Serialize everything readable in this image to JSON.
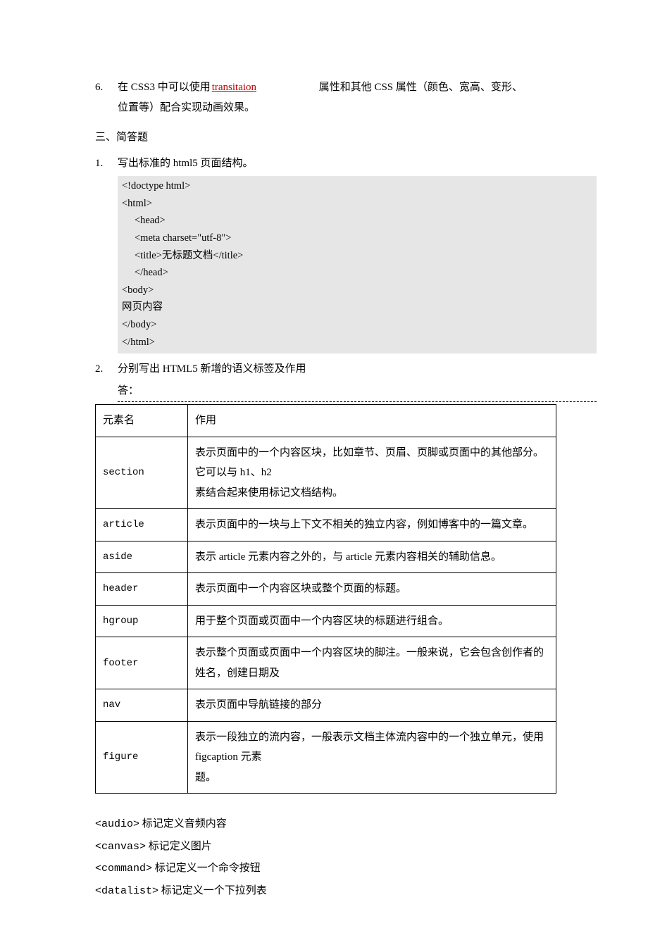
{
  "q6": {
    "num": "6.",
    "pre": "在 CSS3 中可以使用",
    "blank": " transitaion          ",
    "post": "属性和其他 CSS 属性（颜色、宽高、变形、",
    "line2": "位置等）配合实现动画效果。"
  },
  "sec3_title": "三、简答题",
  "sa1": {
    "num": "1.",
    "text": "写出标准的 html5 页面结构。",
    "code": [
      {
        "t": "<!doctype html>",
        "i": 0
      },
      {
        "t": "<html>",
        "i": 0
      },
      {
        "t": "<head>",
        "i": 1
      },
      {
        "t": "<meta charset=\"utf-8\">",
        "i": 1
      },
      {
        "t": "<title>无标题文档</title>",
        "i": 1
      },
      {
        "t": "</head>",
        "i": 1
      },
      {
        "t": "<body>",
        "i": 0
      },
      {
        "t": "网页内容",
        "i": 0
      },
      {
        "t": "</body>",
        "i": 0
      },
      {
        "t": "</html>",
        "i": 0
      }
    ]
  },
  "sa2": {
    "num": "2.",
    "text": "分别写出 HTML5 新增的语义标签及作用",
    "ans_label": "答："
  },
  "table": {
    "headers": [
      "元素名",
      "作用"
    ],
    "rows": [
      [
        "section",
        "表示页面中的一个内容区块，比如章节、页眉、页脚或页面中的其他部分。它可以与 h1、h2\n素结合起来使用标记文档结构。"
      ],
      [
        "article",
        "表示页面中的一块与上下文不相关的独立内容，例如博客中的一篇文章。"
      ],
      [
        "aside",
        "表示 article 元素内容之外的，与 article 元素内容相关的辅助信息。"
      ],
      [
        "header",
        "表示页面中一个内容区块或整个页面的标题。"
      ],
      [
        "hgroup",
        "用于整个页面或页面中一个内容区块的标题进行组合。"
      ],
      [
        "footer",
        "表示整个页面或页面中一个内容区块的脚注。一般来说，它会包含创作者的姓名，创建日期及"
      ],
      [
        "nav",
        "表示页面中导航链接的部分"
      ],
      [
        "figure",
        "表示一段独立的流内容，一般表示文档主体流内容中的一个独立单元，使用 figcaption 元素\n题。"
      ]
    ]
  },
  "extra_tags": [
    {
      "tag": "<audio>",
      "sp": " ",
      "desc": "标记定义音频内容"
    },
    {
      "tag": "<canvas>",
      "sp": "    ",
      "desc": "标记定义图片"
    },
    {
      "tag": "<command>",
      "sp": " ",
      "desc": "标记定义一个命令按钮"
    },
    {
      "tag": "<datalist>",
      "sp": "  ",
      "desc": "标记定义一个下拉列表"
    }
  ]
}
